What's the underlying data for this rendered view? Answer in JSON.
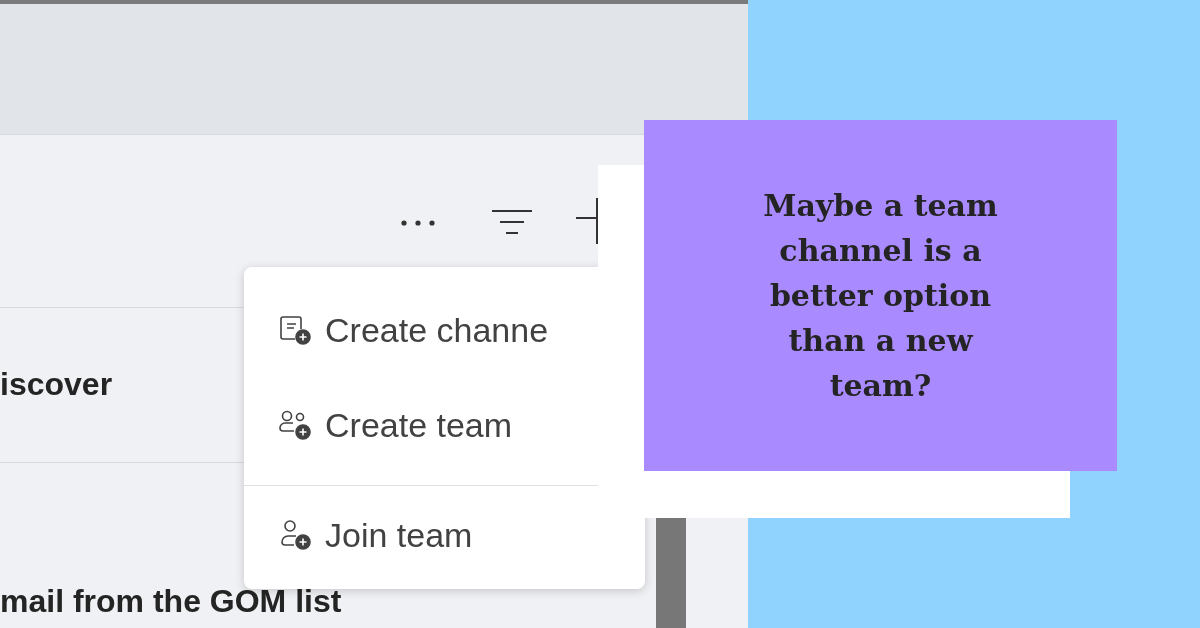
{
  "list_rows": [
    {
      "title": "iscover"
    },
    {
      "title": "mail from the GOM list"
    }
  ],
  "menu": {
    "items": [
      {
        "kind": "channel",
        "label": "Create channe",
        "divider_before": false
      },
      {
        "kind": "team",
        "label": "Create team",
        "divider_before": false
      },
      {
        "kind": "join",
        "label": "Join team",
        "divider_before": true
      }
    ]
  },
  "callout": {
    "lines": [
      "Maybe a team",
      "channel is a",
      "better option",
      "than a new",
      "team?"
    ]
  }
}
